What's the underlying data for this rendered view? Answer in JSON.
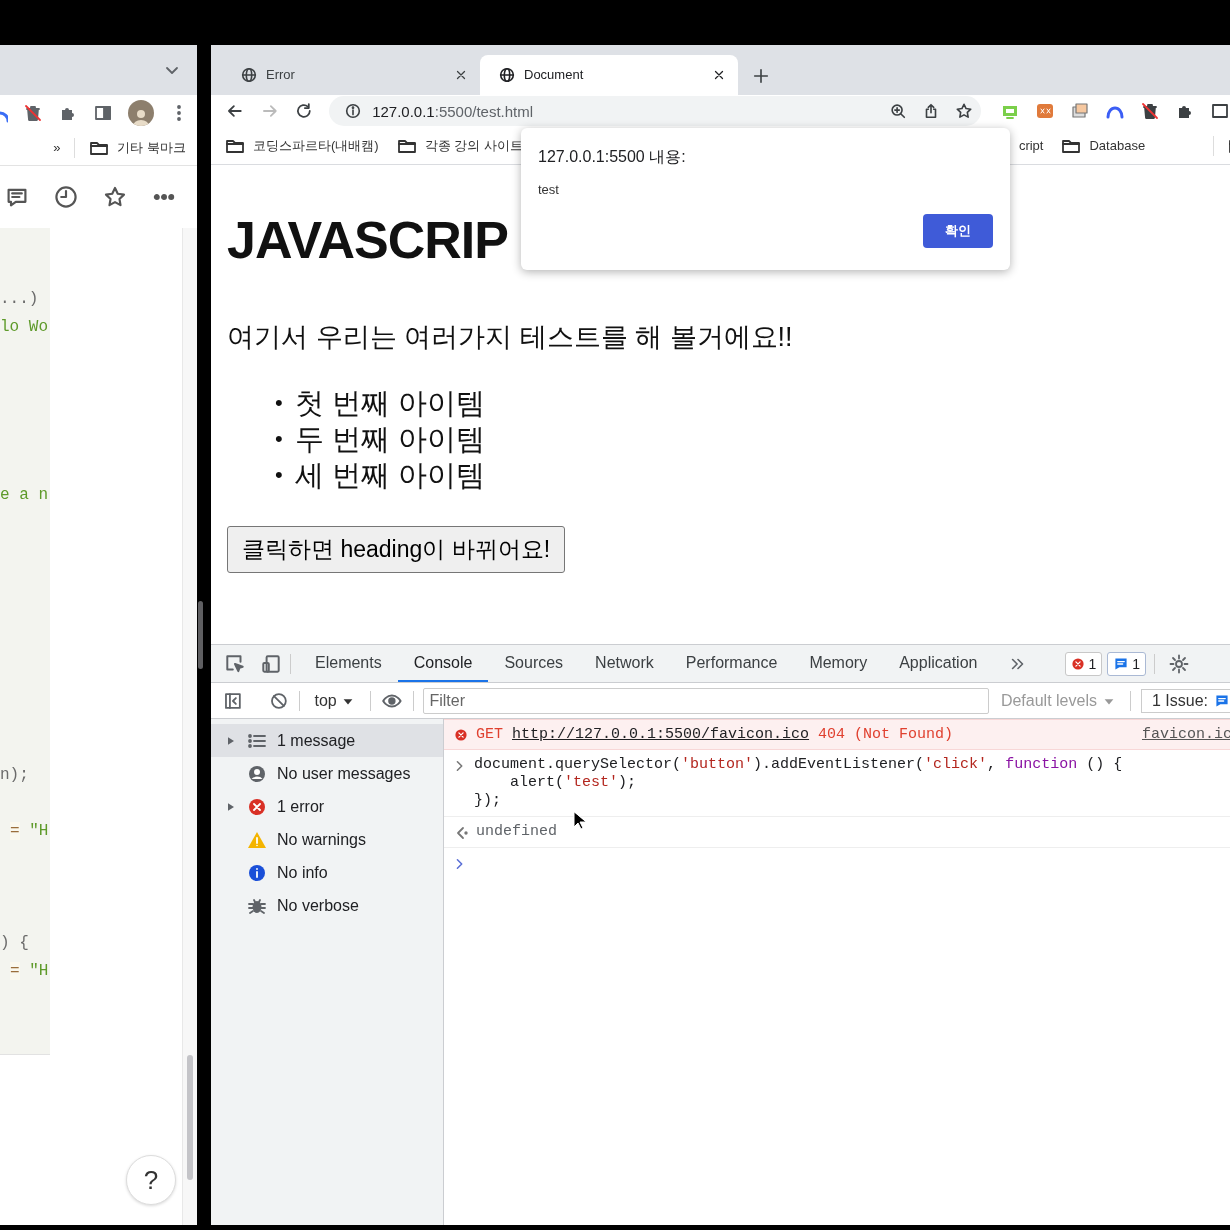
{
  "left_window": {
    "bookmarks_overflow": "»",
    "bookmark_folder": "기타 북마크",
    "code_lines": [
      {
        "indented": false,
        "parts": [
          {
            "text": "...)",
            "kind": "plain"
          }
        ]
      },
      {
        "indented": false,
        "parts": [
          {
            "text": "lo Wo",
            "kind": "string"
          }
        ]
      },
      {
        "indented": false,
        "parts": [
          {
            "text": "e a n",
            "kind": "string"
          }
        ]
      },
      {
        "indented": false,
        "parts": [
          {
            "text": "n);",
            "kind": "plain"
          }
        ]
      },
      {
        "indented": true,
        "parts": [
          {
            "text": "=",
            "kind": "operator"
          },
          {
            "text": " \"H",
            "kind": "string"
          }
        ]
      },
      {
        "indented": false,
        "parts": [
          {
            "text": ") {",
            "kind": "plain"
          }
        ]
      },
      {
        "indented": true,
        "parts": [
          {
            "text": "=",
            "kind": "operator"
          },
          {
            "text": " \"H",
            "kind": "string"
          }
        ]
      }
    ],
    "help_button": "?"
  },
  "browser": {
    "tabs": [
      {
        "title": "Error",
        "selected": false
      },
      {
        "title": "Document",
        "selected": true
      }
    ],
    "address": {
      "host": "127.0.0.1",
      "path": ":5500/test.html"
    },
    "bookmarks_left": [
      {
        "label": "코딩스파르타(내배캠)",
        "kind": "folder"
      },
      {
        "label": "각종 강의 사이트",
        "kind": "folder"
      }
    ],
    "bookmarks_right": [
      {
        "label": "cript",
        "kind": "text"
      },
      {
        "label": "Database",
        "kind": "folder"
      }
    ]
  },
  "dialog": {
    "title": "127.0.0.1:5500 내용:",
    "message": "test",
    "ok_button": "확인"
  },
  "page": {
    "heading": "JAVASCRIP",
    "paragraph": "여기서 우리는 여러가지 테스트를 해 볼거에요!!",
    "list_items": [
      {
        "marker": "•",
        "text": "첫 번째 아이템"
      },
      {
        "marker": "•",
        "text": "두 번째 아이템"
      },
      {
        "marker": "•",
        "text": "세 번째 아이템"
      }
    ],
    "button": "클릭하면 heading이 바뀌어요!"
  },
  "devtools": {
    "tabs": [
      {
        "label": "Elements",
        "selected": false
      },
      {
        "label": "Console",
        "selected": true
      },
      {
        "label": "Sources",
        "selected": false
      },
      {
        "label": "Network",
        "selected": false
      },
      {
        "label": "Performance",
        "selected": false
      },
      {
        "label": "Memory",
        "selected": false
      },
      {
        "label": "Application",
        "selected": false
      }
    ],
    "error_count": "1",
    "message_count": "1",
    "context": "top",
    "filter": {
      "placeholder": "Filter"
    },
    "levels": "Default levels",
    "issues": "1 Issue:",
    "sidebar": [
      {
        "label": "1 message",
        "kind": "list",
        "selected": true,
        "expander": true
      },
      {
        "label": "No user messages",
        "kind": "user",
        "selected": false,
        "expander": false
      },
      {
        "label": "1 error",
        "kind": "error",
        "selected": false,
        "expander": true
      },
      {
        "label": "No warnings",
        "kind": "warning",
        "selected": false,
        "expander": false
      },
      {
        "label": "No info",
        "kind": "info",
        "selected": false,
        "expander": false
      },
      {
        "label": "No verbose",
        "kind": "verbose",
        "selected": false,
        "expander": false
      }
    ],
    "console": [
      {
        "kind": "error",
        "method": "GET",
        "url": "http://127.0.0.1:5500/favicon.ico",
        "status": "404 (Not Found)",
        "source": "favicon.ic"
      },
      {
        "kind": "input",
        "lines": [
          [
            {
              "text": "document.querySelector(",
              "kind": "plain"
            },
            {
              "text": "'button'",
              "kind": "string"
            },
            {
              "text": ").addEventListener(",
              "kind": "plain"
            },
            {
              "text": "'click'",
              "kind": "string"
            },
            {
              "text": ", ",
              "kind": "plain"
            },
            {
              "text": "function",
              "kind": "keyword"
            },
            {
              "text": " () {",
              "kind": "plain"
            }
          ],
          [
            {
              "text": "    alert(",
              "kind": "plain"
            },
            {
              "text": "'test'",
              "kind": "string"
            },
            {
              "text": ");",
              "kind": "plain"
            }
          ],
          [
            {
              "text": "});",
              "kind": "plain"
            }
          ]
        ]
      },
      {
        "kind": "output",
        "text": "undefined"
      },
      {
        "kind": "prompt"
      }
    ]
  }
}
